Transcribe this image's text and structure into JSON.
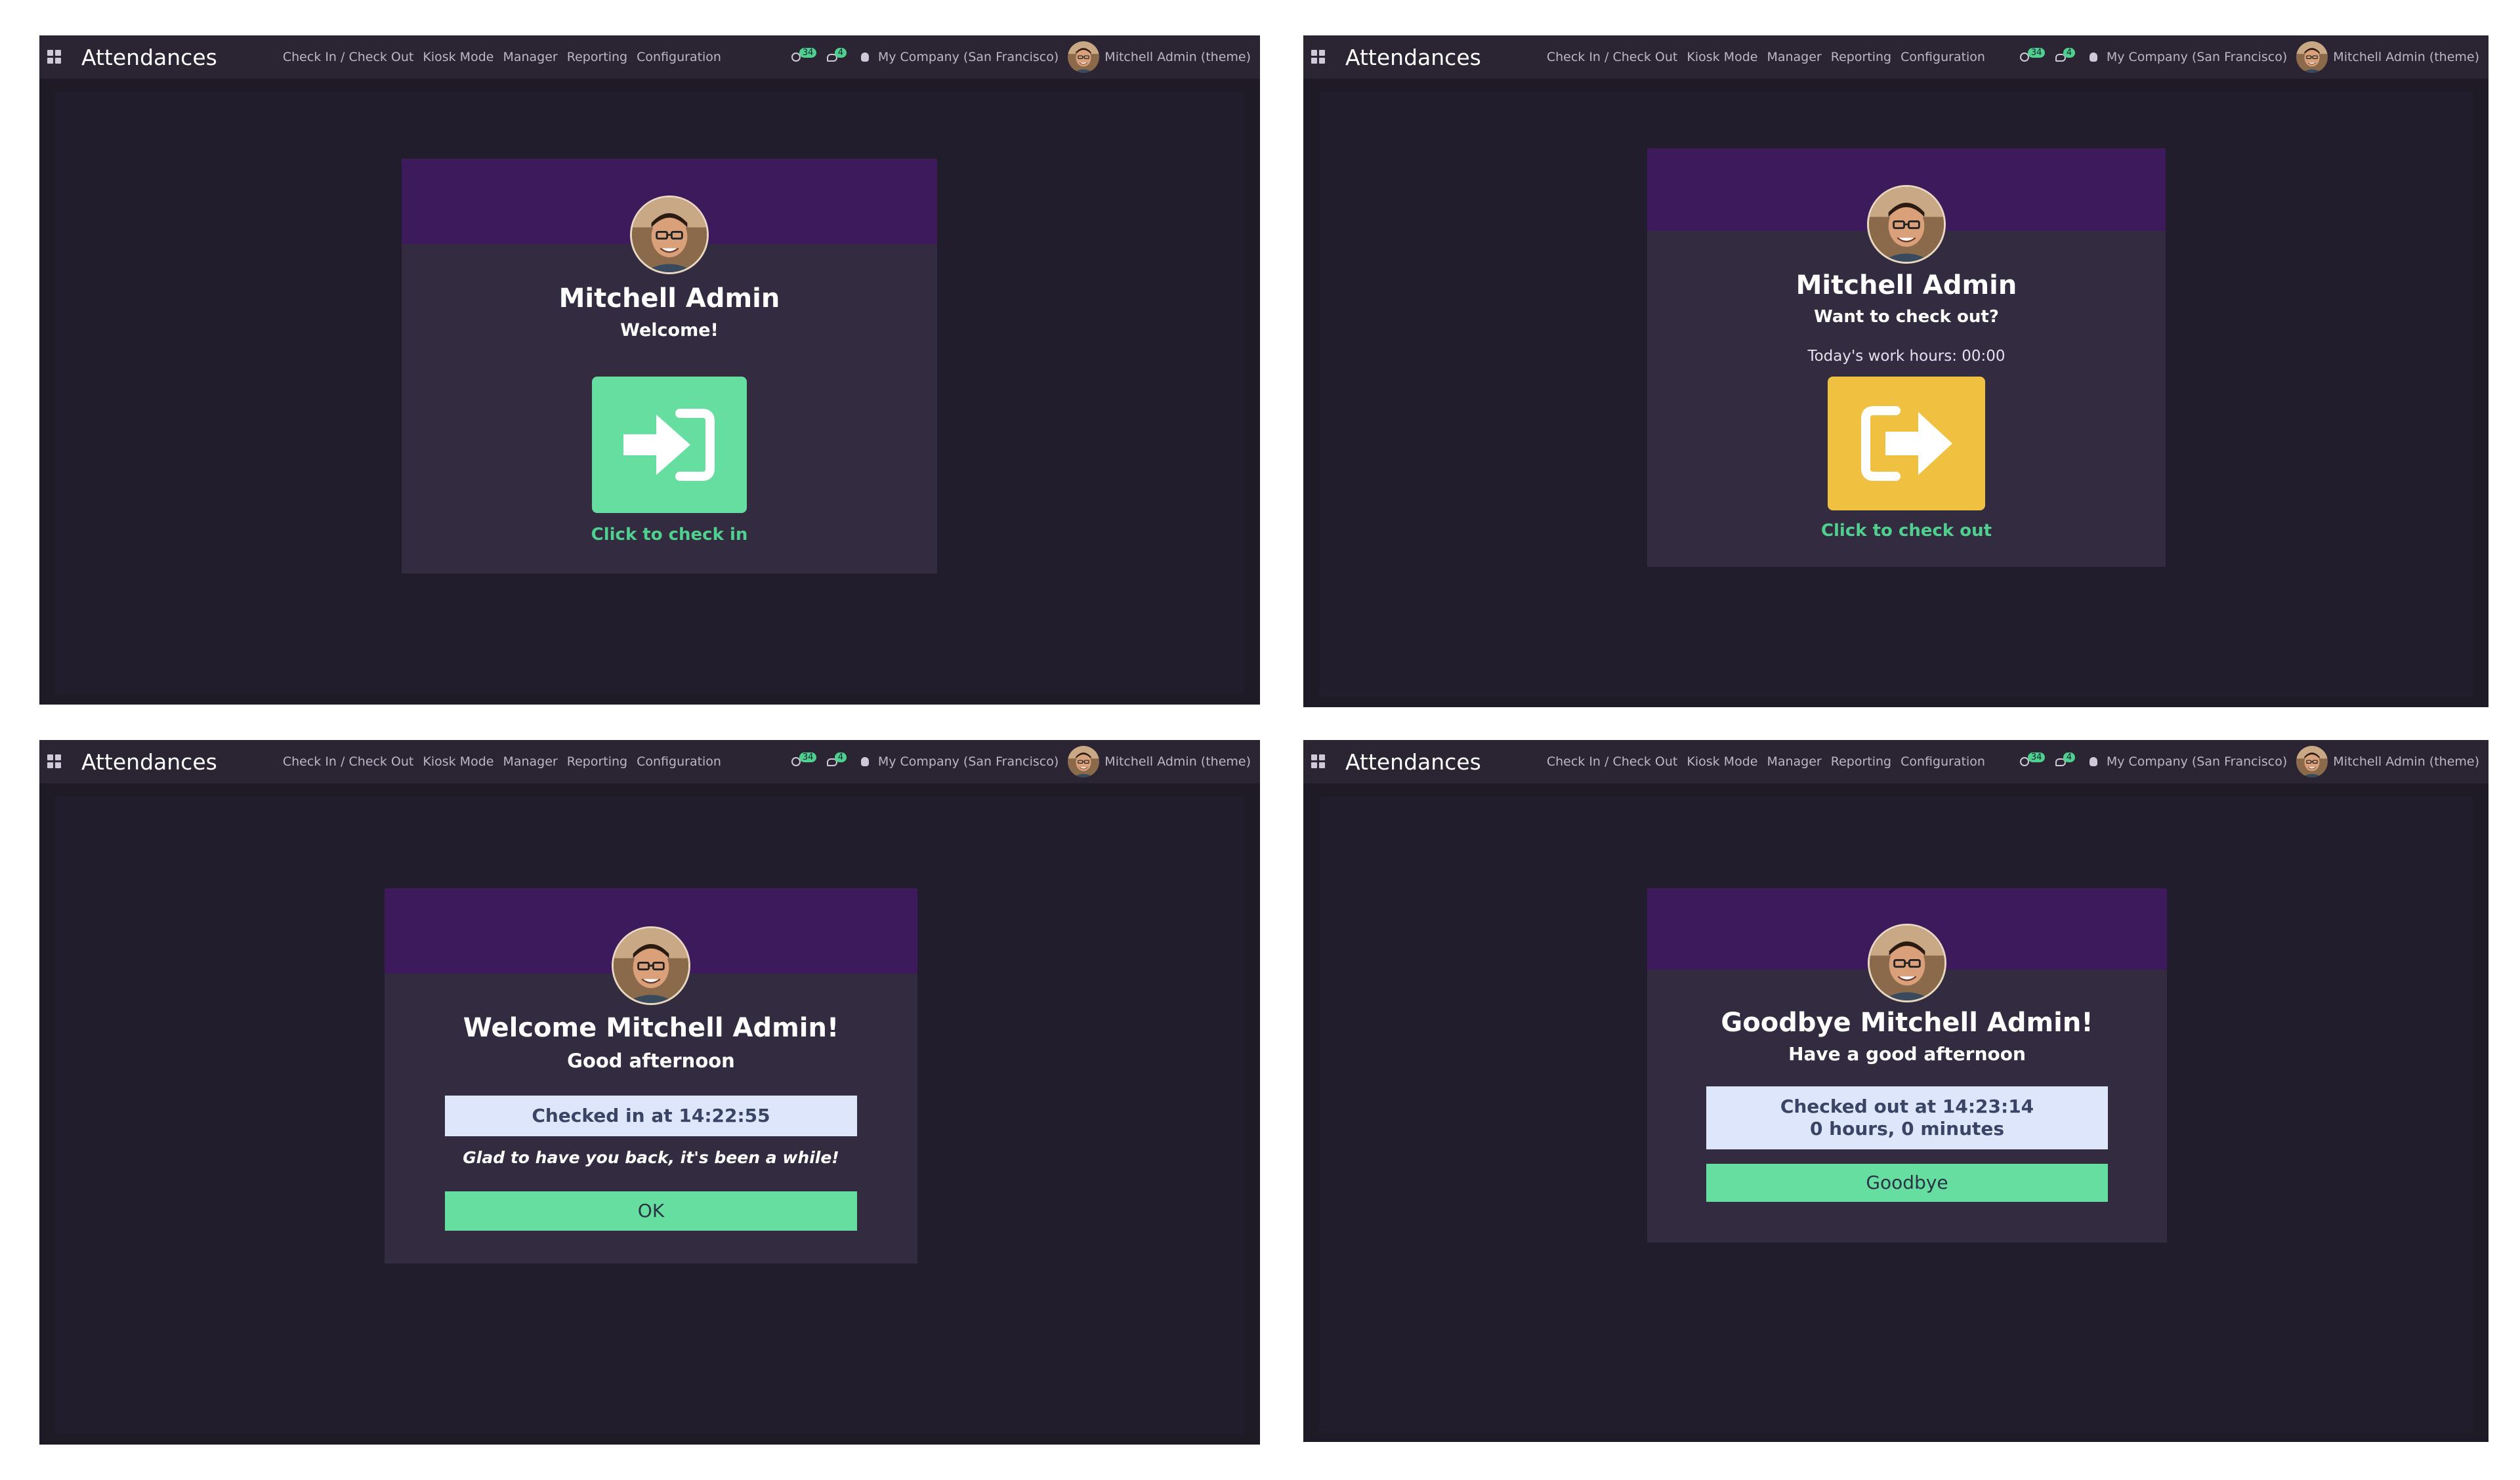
{
  "app_title": "Attendances",
  "menu": [
    "Check In / Check Out",
    "Kiosk Mode",
    "Manager",
    "Reporting",
    "Configuration"
  ],
  "systray": {
    "activity_count": "34",
    "message_count": "4",
    "company": "My Company (San Francisco)",
    "user": "Mitchell Admin (theme)"
  },
  "panels": {
    "check_in": {
      "name": "Mitchell Admin",
      "greeting": "Welcome!",
      "button_hint": "Click to check in"
    },
    "check_out": {
      "name": "Mitchell Admin",
      "greeting": "Want to check out?",
      "work_hours": "Today's work hours: 00:00",
      "button_hint": "Click to check out"
    },
    "checked_in": {
      "title": "Welcome Mitchell Admin!",
      "greeting": "Good afternoon",
      "status": "Checked in at 14:22:55",
      "message": "Glad to have you back, it's been a while!",
      "ok_label": "OK"
    },
    "checked_out": {
      "title": "Goodbye Mitchell Admin!",
      "greeting": "Have a good afternoon",
      "status_line1": "Checked out at 14:23:14",
      "status_line2": "0 hours, 0 minutes",
      "goodbye_label": "Goodbye"
    }
  },
  "colors": {
    "checkin_green": "#66dea0",
    "checkout_yellow": "#f0c040",
    "header_purple": "#3d1a5c",
    "card_bg": "#332b3f",
    "page_bg": "#211d2c"
  }
}
